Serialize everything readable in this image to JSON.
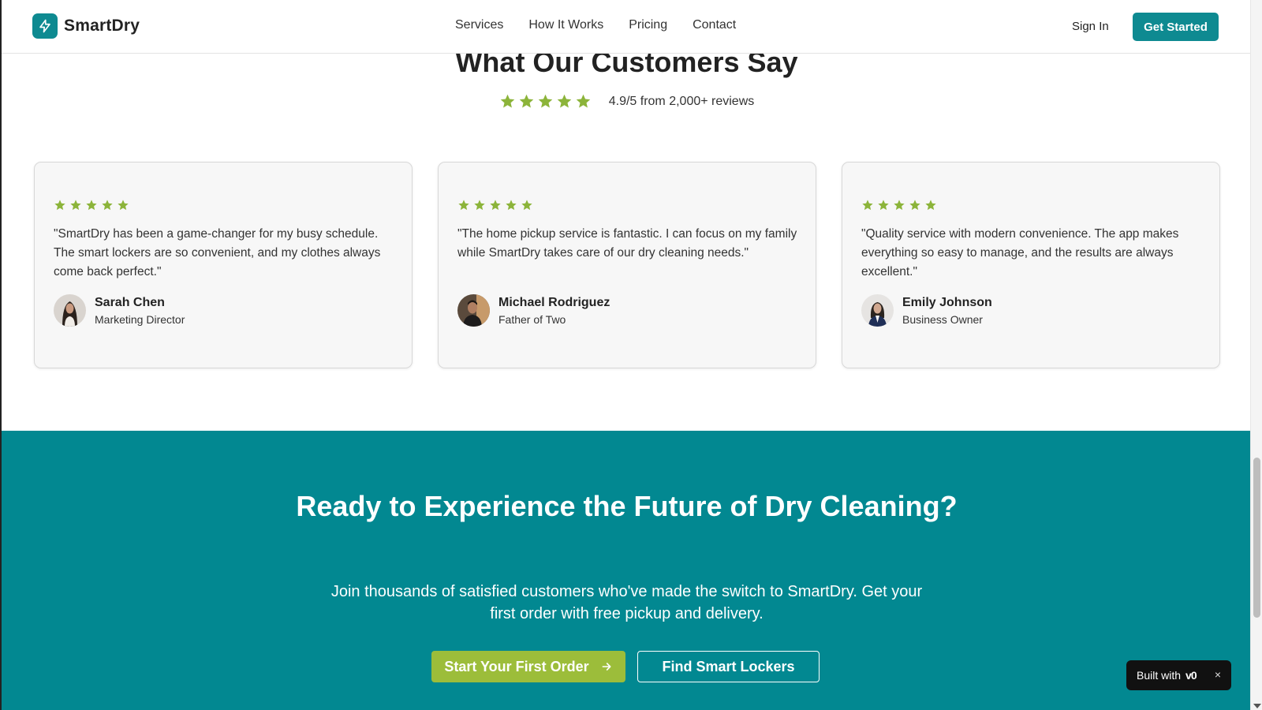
{
  "header": {
    "brand": "SmartDry",
    "nav": [
      "Services",
      "How It Works",
      "Pricing",
      "Contact"
    ],
    "sign_in": "Sign In",
    "get_started": "Get Started"
  },
  "testimonials": {
    "title": "What Our Customers Say",
    "rating_text": "4.9/5 from 2,000+ reviews",
    "rating_stars": 5,
    "cards": [
      {
        "stars": 5,
        "quote": "\"SmartDry has been a game-changer for my busy schedule. The smart lockers are so convenient, and my clothes always come back perfect.\"",
        "name": "Sarah Chen",
        "role": "Marketing Director"
      },
      {
        "stars": 5,
        "quote": "\"The home pickup service is fantastic. I can focus on my family while SmartDry takes care of our dry cleaning needs.\"",
        "name": "Michael Rodriguez",
        "role": "Father of Two"
      },
      {
        "stars": 5,
        "quote": "\"Quality service with modern convenience. The app makes everything so easy to manage, and the results are always excellent.\"",
        "name": "Emily Johnson",
        "role": "Business Owner"
      }
    ]
  },
  "cta": {
    "title": "Ready to Experience the Future of Dry Cleaning?",
    "text": "Join thousands of satisfied customers who've made the switch to SmartDry. Get your first order with free pickup and delivery.",
    "primary_button": "Start Your First Order",
    "secondary_button": "Find Smart Lockers"
  },
  "badge": {
    "label": "Built with",
    "logo_text": "v0",
    "close": "×"
  },
  "colors": {
    "brand_teal": "#028891",
    "star_green": "#8cb43a",
    "cta_button": "#9cbd3a"
  },
  "icons": {
    "logo": "lightning-icon",
    "star": "star-icon",
    "arrow": "arrow-right-icon"
  }
}
